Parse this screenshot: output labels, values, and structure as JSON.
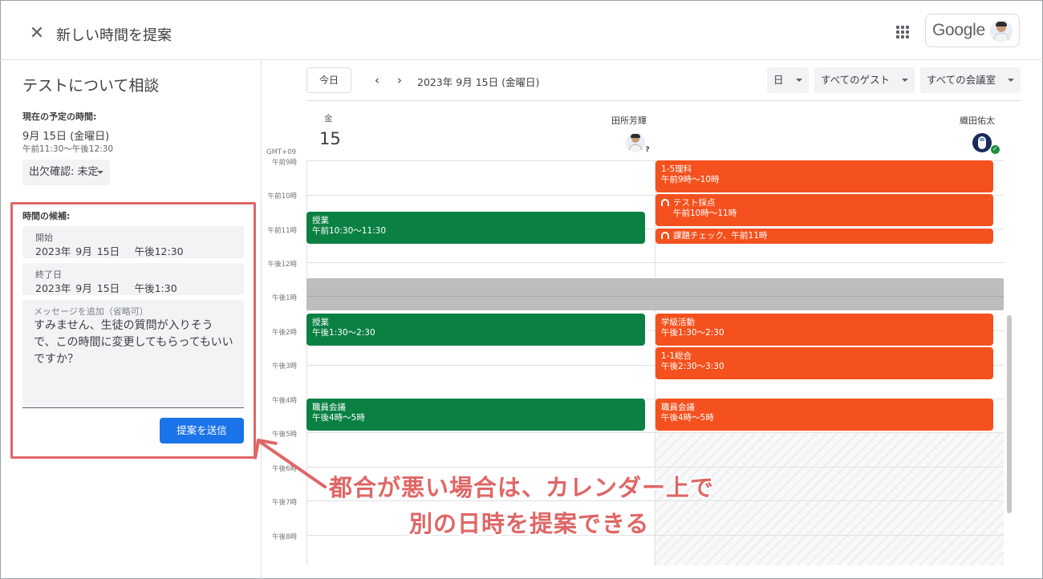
{
  "header": {
    "title": "新しい時間を提案",
    "google_logo_text": "Google"
  },
  "left": {
    "event_title": "テストについて相談",
    "current_label": "現在の予定の時間:",
    "current_date": "9月 15日 (金曜日)",
    "current_time": "午前11:30～午後12:30",
    "rsvp": "出欠確認: 未定",
    "candidate_label": "時間の候補:",
    "start_label": "開始",
    "start_value": "2023年 9月 15日　 午後12:30",
    "end_label": "終了日",
    "end_value": "2023年 9月 15日　 午後1:30",
    "message_placeholder": "メッセージを追加（省略可）",
    "message_text": "すみません、生徒の質問が入りそうで、この時間に変更してもらってもいいですか？",
    "send_label": "提案を送信"
  },
  "toolbar": {
    "today": "今日",
    "date": "2023年 9月 15日 (金曜日)",
    "view": "日",
    "guests": "すべてのゲスト",
    "rooms": "すべての会議室"
  },
  "columns": {
    "day_name": "金",
    "day_number": "15",
    "person1": "田所芳輝",
    "person2": "織田佑太"
  },
  "grid": {
    "timezone": "GMT+09",
    "hours": [
      "午前9時",
      "午前10時",
      "午前11時",
      "午後12時",
      "午後1時",
      "午後2時",
      "午後3時",
      "午後4時",
      "午後5時",
      "午後6時",
      "午後7時",
      "午後8時"
    ]
  },
  "events": {
    "e1_title": "1-5理科",
    "e1_time": "午前9時～10時",
    "e2_title": "テスト採点",
    "e2_time": "午前10時～11時",
    "e3_title": "課題チェック、午前11時",
    "e4_title": "授業",
    "e4_time": "午前10:30～11:30",
    "e5_title": "授業",
    "e5_time": "午後1:30～2:30",
    "e6_title": "学級活動",
    "e6_time": "午後1:30～2:30",
    "e7_title": "1-1総合",
    "e7_time": "午後2:30～3:30",
    "e8_title": "職員会議",
    "e8_time": "午後4時～5時",
    "e9_title": "職員会議",
    "e9_time": "午後4時～5時"
  },
  "annotation": {
    "line1": "都合が悪い場合は、カレンダー上で",
    "line2": "別の日時を提案できる"
  },
  "colors": {
    "green_event": "#0b8043",
    "orange_event": "#f4511e",
    "primary_button": "#1a73e8",
    "annotation": "#e06666"
  }
}
